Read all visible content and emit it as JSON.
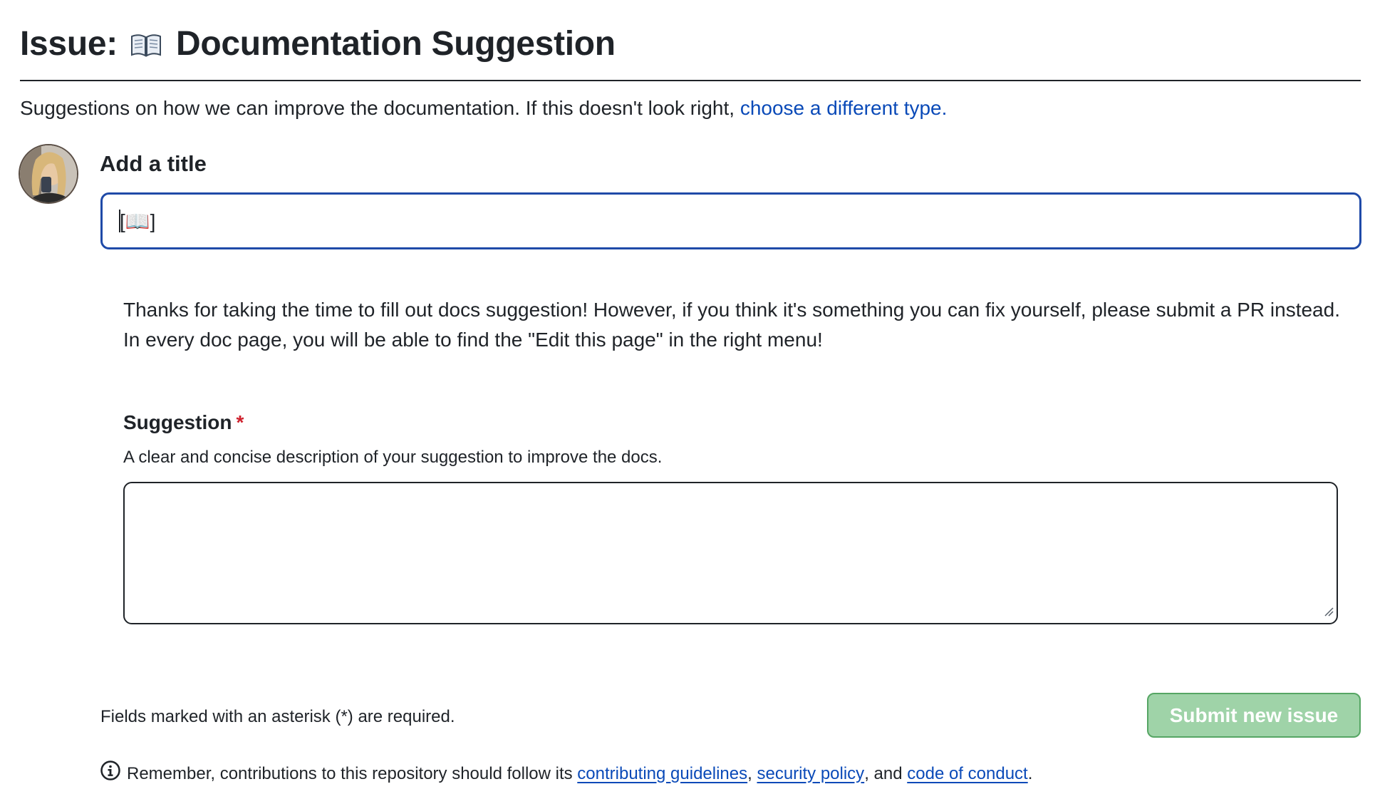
{
  "header": {
    "prefix": "Issue:",
    "template_name": "Documentation Suggestion",
    "icon": "open-book-icon"
  },
  "subtitle": {
    "text": "Suggestions on how we can improve the documentation. If this doesn't look right,",
    "link_label": "choose a different type."
  },
  "title_field": {
    "label": "Add a title",
    "value": "[📖]"
  },
  "intro": {
    "line1": "Thanks for taking the time to fill out docs suggestion! However, if you think it's something you can fix yourself, please submit a PR instead.",
    "line2": "In every doc page, you will be able to find the \"Edit this page\" in the right menu!"
  },
  "suggestion_field": {
    "label": "Suggestion",
    "required_marker": "*",
    "description": "A clear and concise description of your suggestion to improve the docs.",
    "value": ""
  },
  "form_footer": {
    "required_note": "Fields marked with an asterisk (*) are required.",
    "submit_label": "Submit new issue"
  },
  "contribution_note": {
    "prefix": "Remember, contributions to this repository should follow its",
    "link1": "contributing guidelines",
    "sep1": ",",
    "link2": "security policy",
    "sep2": ", and",
    "link3": "code of conduct",
    "end": "."
  },
  "colors": {
    "link": "#0a4ab8",
    "input_focus_border": "#1f4aa8",
    "submit_bg_disabled": "#9fd3a8",
    "required_star": "#cf222e"
  }
}
